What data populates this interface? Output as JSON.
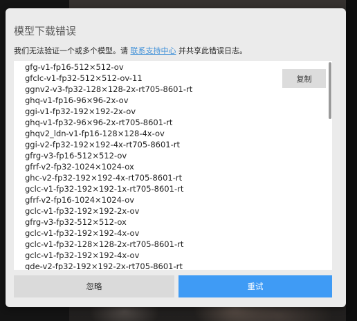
{
  "dialog": {
    "title": "模型下载错误",
    "message_prefix": "我们无法验证一个或多个模型。请 ",
    "support_link": "联系支持中心",
    "message_suffix": " 并共享此错误日志。",
    "copy_label": "复制",
    "ignore_label": "忽略",
    "retry_label": "重试",
    "accent_color": "#3f9bf5",
    "models": [
      "gfg-v1-fp16-512×512-ov",
      "gfclc-v1-fp32-512×512-ov-11",
      "ggnv2-v3-fp32-128×128-2x-rt705-8601-rt",
      "ghq-v1-fp16-96×96-2x-ov",
      "ggi-v1-fp32-192×192-2x-ov",
      "ghq-v1-fp32-96×96-2x-rt705-8601-rt",
      "ghqv2_ldn-v1-fp16-128×128-4x-ov",
      "ggi-v2-fp32-192×192-4x-rt705-8601-rt",
      "gfrg-v3-fp16-512×512-ov",
      "gfrf-v2-fp32-1024×1024-ox",
      "ghc-v2-fp32-192×192-4x-rt705-8601-rt",
      "gclc-v1-fp32-192×192-1x-rt705-8601-rt",
      "gfrf-v2-fp16-1024×1024-ov",
      "gclc-v1-fp32-192×192-2x-ov",
      "gfrg-v3-fp32-512×512-ox",
      "gclc-v1-fp32-192×192-4x-ov",
      "gclc-v1-fp32-128×128-2x-rt705-8601-rt",
      "gclc-v1-fp32-192×192-4x-ov",
      "gde-v2-fp32-192×192-2x-rt705-8601-rt"
    ]
  }
}
